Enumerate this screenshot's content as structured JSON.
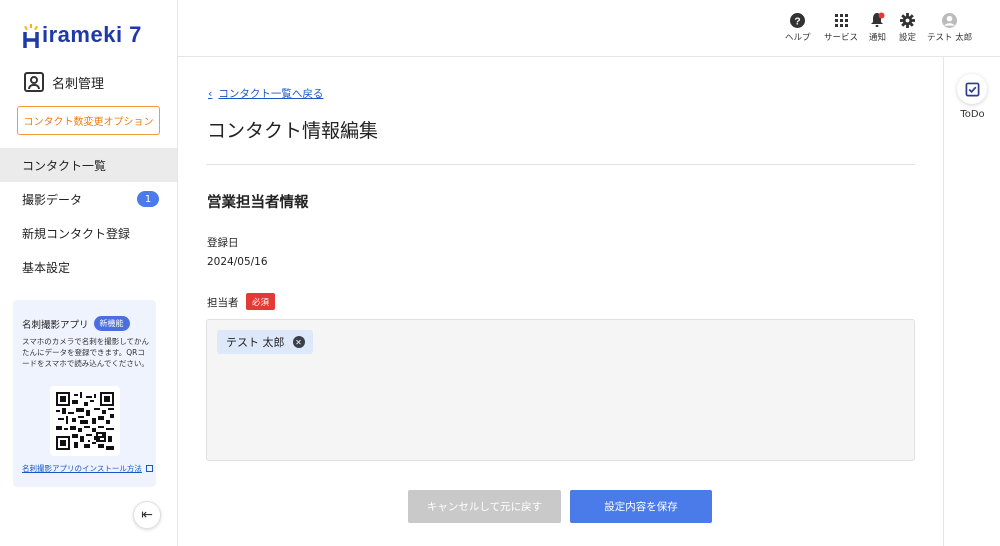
{
  "app": {
    "logo_text": "irameki 7",
    "brand_color": "#1f3aa8",
    "accent_color": "#4a7be8"
  },
  "sidebar": {
    "module_icon": "business-card-icon",
    "module_label": "名刺管理",
    "option_button": "コンタクト数変更オプション",
    "items": [
      {
        "label": "コンタクト一覧",
        "active": true
      },
      {
        "label": "撮影データ",
        "badge": "1"
      },
      {
        "label": "新規コンタクト登録"
      },
      {
        "label": "基本設定"
      }
    ],
    "app_card": {
      "title": "名刺撮影アプリ",
      "badge": "新機能",
      "description": "スマホのカメラで名刺を撮影してかんたんにデータを登録できます。QRコードをスマホで読み込んでください。",
      "install_link": "名刺撮影アプリのインストール方法"
    },
    "collapse_icon": "collapse-left-icon"
  },
  "header": {
    "items": [
      {
        "label": "ヘルプ",
        "icon": "help-icon"
      },
      {
        "label": "サービス",
        "icon": "grid-icon"
      },
      {
        "label": "通知",
        "icon": "bell-icon"
      },
      {
        "label": "設定",
        "icon": "gear-icon"
      },
      {
        "label": "テスト 太郎",
        "icon": "user-icon"
      }
    ]
  },
  "right_rail": {
    "todo_label": "ToDo",
    "todo_icon": "checkbox-icon"
  },
  "main": {
    "back_link": "コンタクト一覧へ戻る",
    "title": "コンタクト情報編集",
    "section_title": "営業担当者情報",
    "registered_label": "登録日",
    "registered_value": "2024/05/16",
    "assignee_label": "担当者",
    "required_badge": "必須",
    "assignee_chip": "テスト 太郎",
    "cancel_button": "キャンセルして元に戻す",
    "save_button": "設定内容を保存"
  }
}
